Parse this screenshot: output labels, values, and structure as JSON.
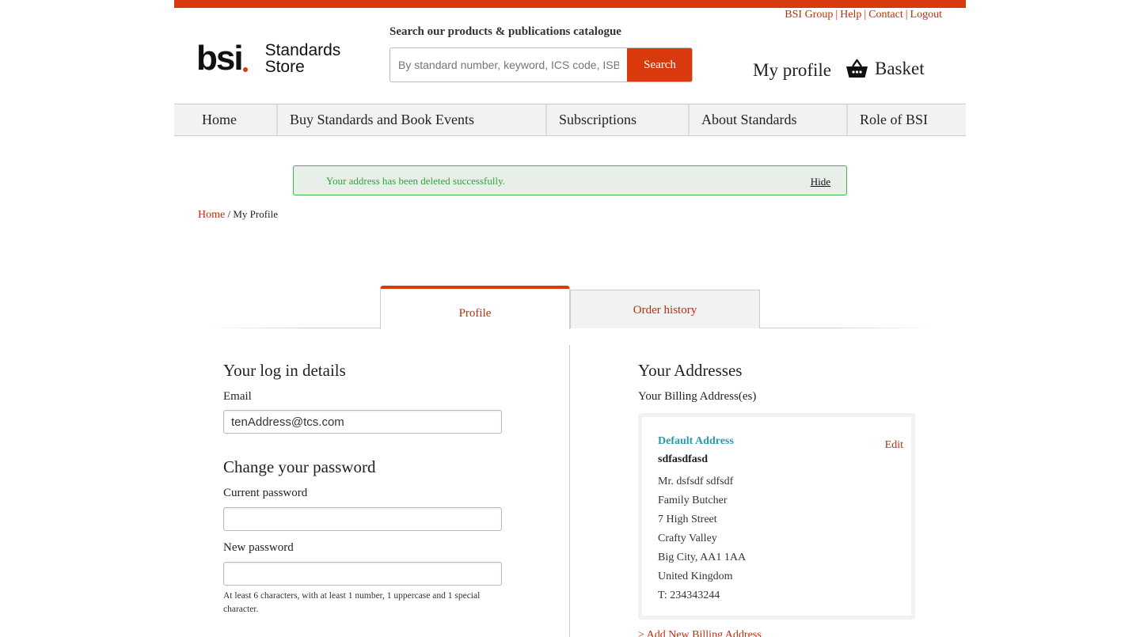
{
  "header": {
    "top_links": [
      "BSI Group",
      "Help",
      "Contact",
      "Logout"
    ],
    "logo_text": "bsi",
    "logo_store_line1": "Standards",
    "logo_store_line2": "Store",
    "search_label": "Search our products & publications catalogue",
    "search_placeholder": "By standard number, keyword, ICS code, ISBN",
    "search_button": "Search",
    "my_profile": "My profile",
    "basket": "Basket"
  },
  "nav": {
    "items": [
      "Home",
      "Buy Standards and Book Events",
      "Subscriptions",
      "About Standards",
      "Role of BSI"
    ]
  },
  "alert": {
    "message": "Your address has been deleted successfully.",
    "hide": "Hide"
  },
  "breadcrumb": {
    "home": "Home",
    "separator": " / ",
    "current": "My Profile"
  },
  "tabs": {
    "profile": "Profile",
    "order_history": "Order history"
  },
  "login": {
    "heading": "Your log in details",
    "email_label": "Email",
    "email_value": "tenAddress@tcs.com"
  },
  "password": {
    "heading": "Change your password",
    "current_label": "Current password",
    "new_label": "New password",
    "hint": "At least 6 characters, with at least 1 number, 1 uppercase and 1 special character."
  },
  "addresses": {
    "heading": "Your Addresses",
    "billing_label": "Your Billing Address(es)",
    "default_label": "Default Address",
    "edit": "Edit",
    "name": "sdfasdfasd",
    "lines": [
      "Mr. dsfsdf sdfsdf",
      "Family Butcher",
      "7 High Street",
      "Crafty Valley",
      "Big City, AA1 1AA",
      "United Kingdom",
      "T: 234343244"
    ],
    "add_new": "> Add New Billing Address"
  },
  "colors": {
    "brand_red": "#d83a0d",
    "link_red": "#c42b0a",
    "success_green": "#2fa43a",
    "teal": "#2a9aa8"
  }
}
